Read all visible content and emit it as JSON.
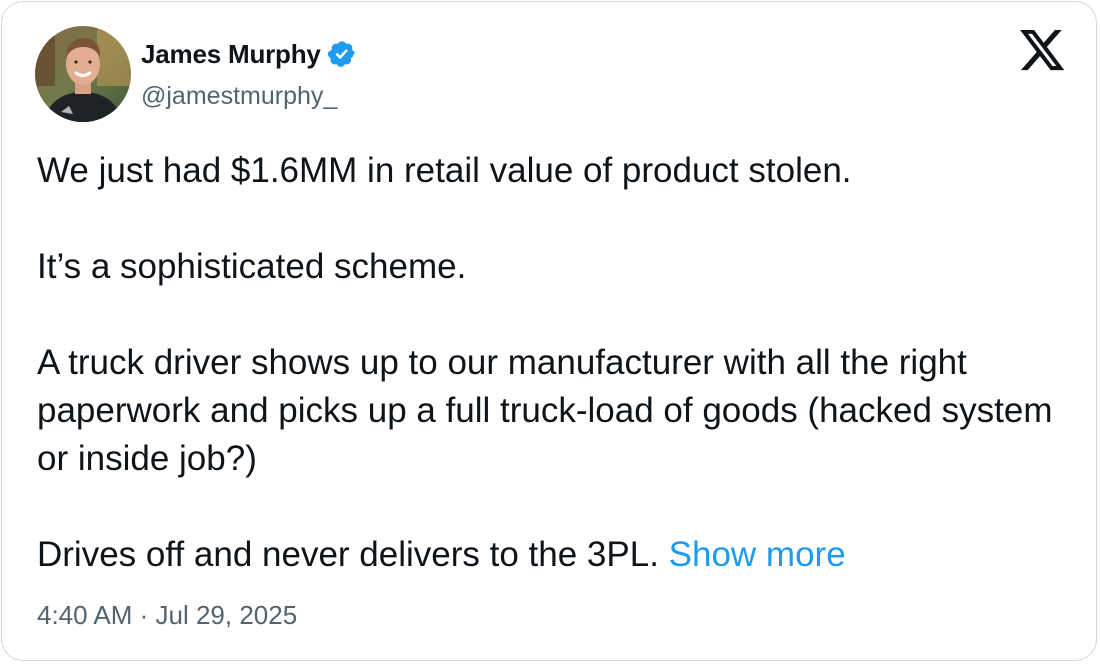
{
  "author": {
    "name": "James Murphy",
    "handle": "@jamestmurphy_",
    "verified": true,
    "avatar_icon": "profile-photo"
  },
  "tweet": {
    "paragraphs": [
      "We just had $1.6MM in retail value of product stolen.",
      "It’s a sophisticated scheme.",
      "A truck driver shows up to our manufacturer with all the right paperwork and picks up a full truck-load of goods (hacked system or inside job?)"
    ],
    "last_paragraph": "Drives off and never delivers to the 3PL.",
    "show_more_label": "Show more"
  },
  "timestamp": "4:40 AM · Jul 29, 2025",
  "colors": {
    "accent": "#1d9bf0",
    "text": "#0f1419",
    "muted": "#536471",
    "border": "#cfd9de"
  },
  "icons": {
    "verified": "verified-badge-icon",
    "platform": "x-logo-icon"
  }
}
